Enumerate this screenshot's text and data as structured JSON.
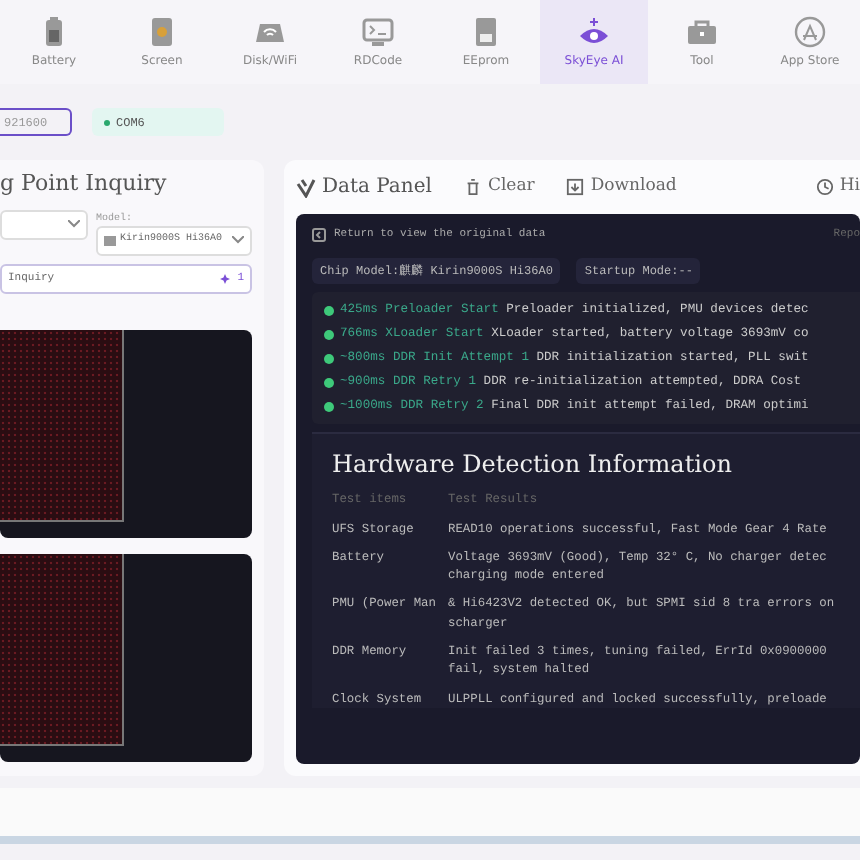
{
  "tabs": [
    {
      "label": "Battery",
      "kind": "battery",
      "selected": false
    },
    {
      "label": "Screen",
      "kind": "screen",
      "selected": false
    },
    {
      "label": "Disk/WiFi",
      "kind": "disk",
      "selected": false
    },
    {
      "label": "RDCode",
      "kind": "terminal",
      "selected": false
    },
    {
      "label": "EEprom",
      "kind": "chip",
      "selected": false
    },
    {
      "label": "SkyEye AI",
      "kind": "eye",
      "selected": true
    },
    {
      "label": "Tool",
      "kind": "toolbox",
      "selected": false
    },
    {
      "label": "App Store",
      "kind": "store",
      "selected": false
    }
  ],
  "port": {
    "baud": "921600",
    "com": "COM6"
  },
  "left": {
    "title": "g Point Inquiry",
    "model_label": "Model:",
    "model": "Kirin9000S Hi36A0",
    "search": "Inquiry",
    "count": "1",
    "images": [
      {
        "kind": "heatmap"
      },
      {
        "kind": "heatmap"
      }
    ]
  },
  "right": {
    "title": "Data Panel",
    "actions": [
      {
        "label": "Clear",
        "kind": "trash"
      },
      {
        "label": "Download",
        "kind": "download"
      },
      {
        "label": "Hi",
        "kind": "history"
      }
    ],
    "back": "Return to view the original data",
    "export": "Repo",
    "chip": "Chip Model:麒麟 Kirin9000S Hi36A0",
    "startup": "Startup Mode:--",
    "log": [
      {
        "time": "425ms Preloader Start",
        "text": "Preloader initialized, PMU devices detec"
      },
      {
        "time": "766ms XLoader Start",
        "text": "XLoader started, battery voltage 3693mV co"
      },
      {
        "time": "~800ms DDR Init Attempt 1",
        "text": "DDR initialization started, PLL swit"
      },
      {
        "time": "~900ms DDR Retry 1",
        "text": "DDR re-initialization attempted, DDRA Cost "
      },
      {
        "time": "~1000ms DDR Retry 2",
        "text": "Final DDR init attempt failed, DRAM optimi"
      }
    ],
    "hw": {
      "title": "Hardware Detection Information",
      "columns": [
        "Test items",
        "Test Results"
      ],
      "rows": [
        {
          "item": "UFS Storage",
          "result": "READ10 operations successful, Fast Mode Gear 4 Rate"
        },
        {
          "item": "Battery",
          "result": "Voltage 3693mV (Good), Temp 32° C, No charger detec charging mode entered"
        },
        {
          "item": "PMU (Power Man",
          "result": "& Hi6423V2 detected OK, but SPMI sid 8 tra errors on scharger"
        },
        {
          "item": "DDR Memory",
          "result": "Init failed 3 times, tuning failed, ErrId 0x0900000 fail, system halted"
        },
        {
          "item": "Clock System",
          "result": "ULPPLL configured and locked successfully, preloade"
        }
      ]
    }
  }
}
